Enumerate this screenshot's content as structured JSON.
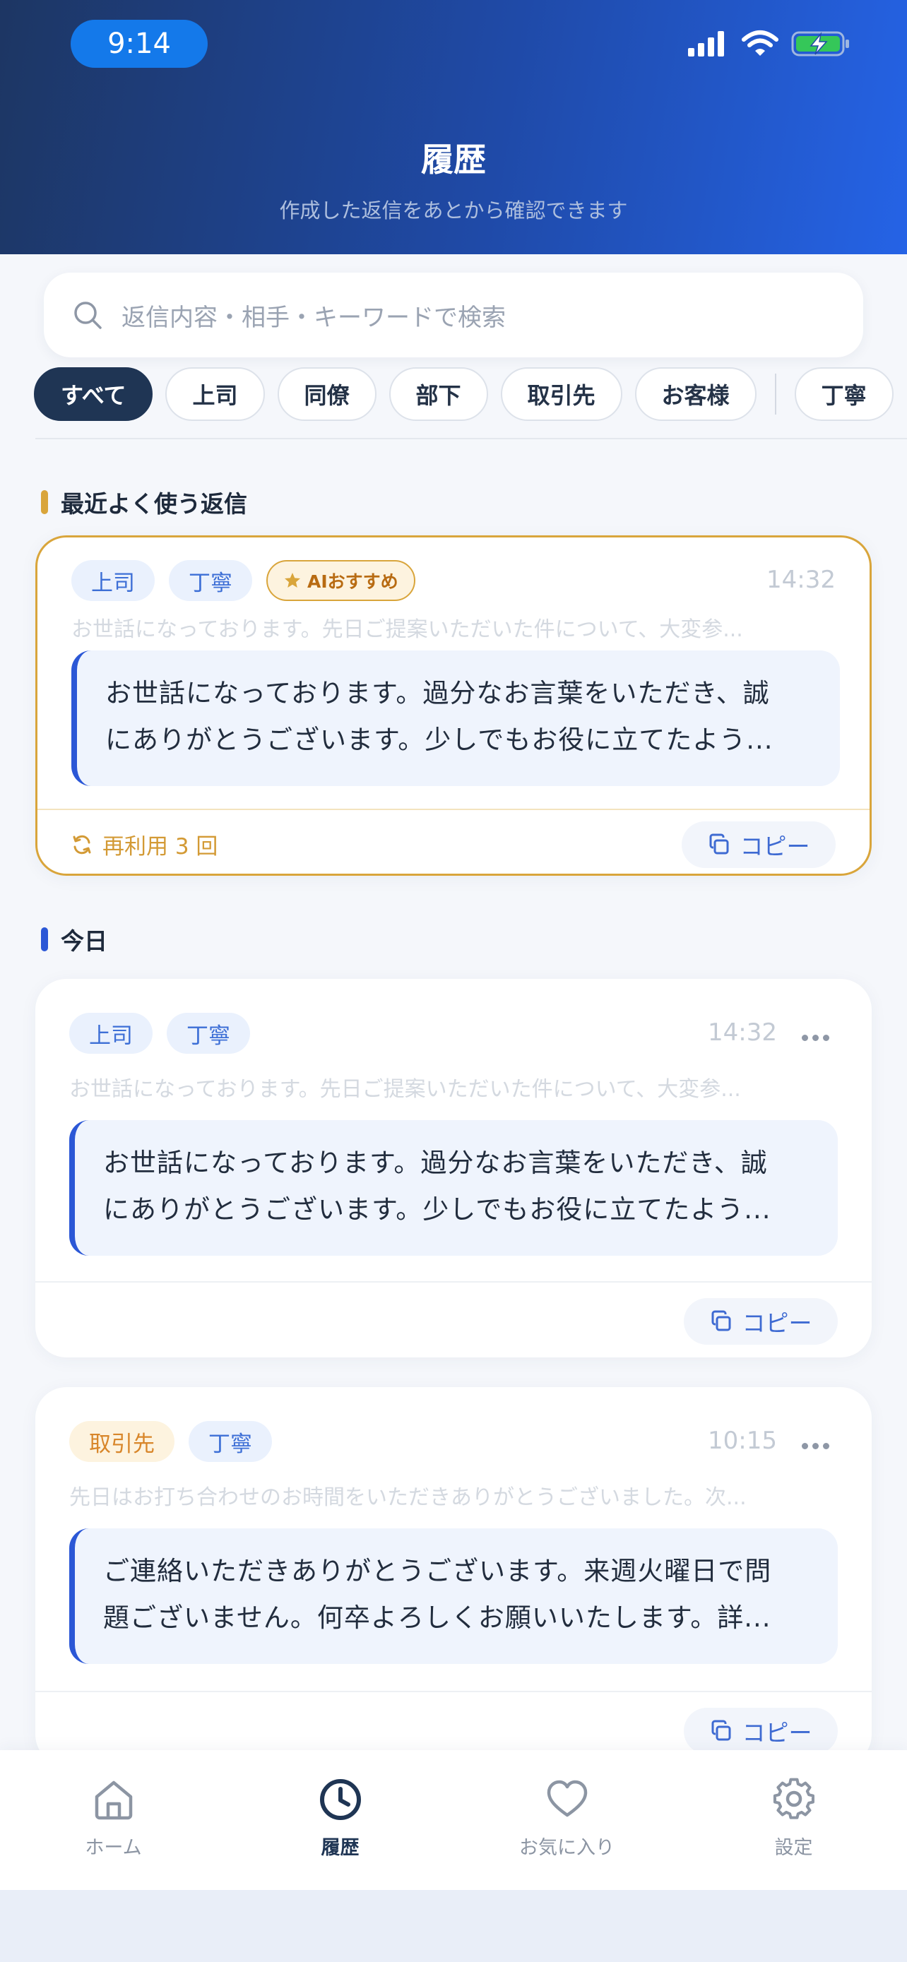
{
  "status_bar": {
    "time": "9:14"
  },
  "header": {
    "title": "履歴",
    "subtitle": "作成した返信をあとから確認できます"
  },
  "search": {
    "placeholder": "返信内容・相手・キーワードで検索"
  },
  "filters": {
    "items": [
      "すべて",
      "上司",
      "同僚",
      "部下",
      "取引先",
      "お客様",
      "丁寧"
    ],
    "selected": "すべて"
  },
  "sections": {
    "frequent": {
      "title": "最近よく使う返信",
      "accent": "#d9a53b"
    },
    "today": {
      "title": "今日",
      "accent": "#2b57d6"
    }
  },
  "frequent_card": {
    "tags": [
      "上司",
      "丁寧"
    ],
    "ai_badge": "AIおすすめ",
    "time": "14:32",
    "original": "お世話になっております。先日ご提案いただいた件について、大変参...",
    "reply_line1": "お世話になっております。過分なお言葉をいただき、誠",
    "reply_line2": "にありがとうございます。少しでもお役に立てたよう...",
    "reuse": "再利用 3 回",
    "copy": "コピー"
  },
  "history": [
    {
      "tags": [
        "上司",
        "丁寧"
      ],
      "time": "14:32",
      "original": "お世話になっております。先日ご提案いただいた件について、大変参...",
      "reply_line1": "お世話になっております。過分なお言葉をいただき、誠",
      "reply_line2": "にありがとうございます。少しでもお役に立てたよう...",
      "copy": "コピー"
    },
    {
      "tags": [
        "取引先",
        "丁寧"
      ],
      "time": "10:15",
      "original": "先日はお打ち合わせのお時間をいただきありがとうございました。次...",
      "reply_line1": "ご連絡いただきありがとうございます。来週火曜日で問",
      "reply_line2": "題ございません。何卒よろしくお願いいたします。詳...",
      "copy": "コピー"
    }
  ],
  "tabbar": {
    "items": [
      {
        "label": "ホーム",
        "icon": "home-icon"
      },
      {
        "label": "履歴",
        "icon": "clock-icon"
      },
      {
        "label": "お気に入り",
        "icon": "heart-icon"
      },
      {
        "label": "設定",
        "icon": "gear-icon"
      }
    ],
    "active": "履歴"
  },
  "colors": {
    "header_start": "#1d3663",
    "header_end": "#2563e6",
    "accent_blue": "#2b57d6",
    "accent_gold": "#d9a53b",
    "chip_active": "#1f3554"
  }
}
